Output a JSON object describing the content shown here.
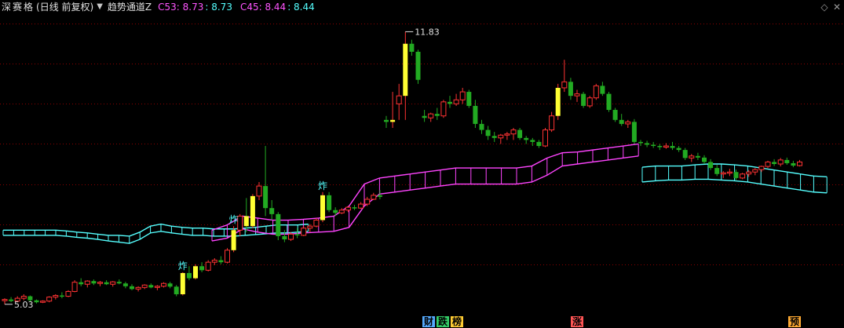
{
  "header": {
    "stock_name": "深赛格",
    "period": "(日线 前复权)",
    "dropdown_icon": "chevron-down-icon",
    "indicator_name": "趋势通道Z",
    "c53_label": "C53: 8.73",
    "c53_value": ": 8.73",
    "c45_label": "C45: 8.44",
    "c45_value": ": 8.44"
  },
  "window_controls": {
    "up_icon": "chevron-up-icon",
    "close_icon": "close-icon",
    "up_glyph": "◇",
    "close_glyph": "✕"
  },
  "price_annotations": {
    "high": "11.83",
    "low": "5.03"
  },
  "signals": {
    "explode_label": "炸"
  },
  "event_marks": [
    {
      "label": "财",
      "color": "#55aaff"
    },
    {
      "label": "跌",
      "color": "#33cc66"
    },
    {
      "label": "榜",
      "color": "#ffcc33"
    },
    {
      "label": "涨",
      "color": "#ff5555"
    },
    {
      "label": "预",
      "color": "#ffaa33"
    }
  ],
  "colors": {
    "up": "#ff3333",
    "down": "#22aa22",
    "limit_up": "#ffff33",
    "channel_cyan": "#55ffff",
    "channel_magenta": "#ff44ff",
    "grid": "#8b0000"
  },
  "chart_data": {
    "type": "candlestick",
    "y_range": [
      4.8,
      12.2
    ],
    "candles": [
      [
        5.1,
        5.15,
        5.0,
        5.12
      ],
      [
        5.12,
        5.18,
        5.05,
        5.08
      ],
      [
        5.08,
        5.2,
        5.05,
        5.15
      ],
      [
        5.15,
        5.25,
        5.1,
        5.2
      ],
      [
        5.2,
        5.22,
        5.05,
        5.1
      ],
      [
        5.1,
        5.12,
        5.02,
        5.05
      ],
      [
        5.05,
        5.1,
        5.03,
        5.08
      ],
      [
        5.08,
        5.2,
        5.05,
        5.18
      ],
      [
        5.18,
        5.25,
        5.12,
        5.22
      ],
      [
        5.22,
        5.3,
        5.15,
        5.2
      ],
      [
        5.2,
        5.35,
        5.18,
        5.32
      ],
      [
        5.32,
        5.6,
        5.3,
        5.55
      ],
      [
        5.55,
        5.65,
        5.45,
        5.5
      ],
      [
        5.5,
        5.6,
        5.42,
        5.58
      ],
      [
        5.58,
        5.62,
        5.48,
        5.52
      ],
      [
        5.52,
        5.58,
        5.45,
        5.55
      ],
      [
        5.55,
        5.6,
        5.48,
        5.5
      ],
      [
        5.5,
        5.58,
        5.44,
        5.56
      ],
      [
        5.56,
        5.62,
        5.5,
        5.52
      ],
      [
        5.52,
        5.56,
        5.4,
        5.45
      ],
      [
        5.45,
        5.5,
        5.35,
        5.38
      ],
      [
        5.38,
        5.45,
        5.32,
        5.42
      ],
      [
        5.42,
        5.5,
        5.38,
        5.48
      ],
      [
        5.48,
        5.52,
        5.4,
        5.42
      ],
      [
        5.42,
        5.48,
        5.35,
        5.45
      ],
      [
        5.45,
        5.55,
        5.42,
        5.52
      ],
      [
        5.52,
        5.56,
        5.4,
        5.44
      ],
      [
        5.44,
        5.48,
        5.2,
        5.25
      ],
      [
        5.25,
        5.8,
        5.22,
        5.78
      ],
      [
        5.78,
        5.95,
        5.6,
        5.65
      ],
      [
        5.65,
        6.0,
        5.62,
        5.95
      ],
      [
        5.95,
        6.05,
        5.8,
        5.85
      ],
      [
        5.85,
        6.1,
        5.82,
        6.05
      ],
      [
        6.05,
        6.15,
        5.98,
        6.1
      ],
      [
        6.1,
        6.2,
        6.0,
        6.05
      ],
      [
        6.05,
        6.4,
        6.02,
        6.35
      ],
      [
        6.35,
        6.95,
        6.3,
        6.85
      ],
      [
        6.85,
        7.25,
        6.7,
        7.2
      ],
      [
        7.2,
        7.65,
        6.8,
        6.95
      ],
      [
        6.95,
        7.75,
        6.9,
        7.7
      ],
      [
        7.7,
        8.05,
        7.6,
        7.95
      ],
      [
        7.95,
        8.95,
        7.2,
        7.4
      ],
      [
        7.4,
        7.6,
        7.1,
        7.25
      ],
      [
        7.25,
        7.3,
        6.6,
        6.7
      ],
      [
        6.7,
        6.85,
        6.55,
        6.62
      ],
      [
        6.62,
        6.8,
        6.58,
        6.75
      ],
      [
        6.75,
        6.9,
        6.65,
        6.72
      ],
      [
        6.72,
        6.95,
        6.7,
        6.9
      ],
      [
        6.9,
        7.0,
        6.8,
        6.95
      ],
      [
        6.95,
        7.15,
        6.92,
        7.1
      ],
      [
        7.1,
        7.8,
        7.05,
        7.72
      ],
      [
        7.72,
        7.8,
        7.3,
        7.35
      ],
      [
        7.35,
        7.42,
        7.2,
        7.28
      ],
      [
        7.28,
        7.4,
        7.25,
        7.35
      ],
      [
        7.35,
        7.45,
        7.3,
        7.42
      ],
      [
        7.42,
        7.48,
        7.35,
        7.4
      ],
      [
        7.4,
        7.55,
        7.38,
        7.5
      ],
      [
        7.5,
        7.68,
        7.45,
        7.62
      ],
      [
        7.62,
        7.78,
        7.6,
        7.72
      ],
      [
        7.72,
        7.85,
        7.62,
        7.68
      ],
      [
        9.6,
        9.7,
        9.4,
        9.55
      ],
      [
        9.55,
        10.3,
        9.4,
        9.6
      ],
      [
        10.0,
        10.5,
        9.6,
        10.2
      ],
      [
        10.2,
        11.8,
        9.6,
        11.5
      ],
      [
        11.5,
        11.6,
        11.2,
        11.3
      ],
      [
        11.3,
        11.35,
        10.5,
        10.6
      ],
      [
        9.7,
        9.85,
        9.55,
        9.65
      ],
      [
        9.65,
        9.78,
        9.55,
        9.75
      ],
      [
        9.75,
        9.9,
        9.6,
        9.7
      ],
      [
        9.7,
        10.1,
        9.65,
        10.05
      ],
      [
        10.05,
        10.2,
        9.9,
        10.0
      ],
      [
        10.0,
        10.25,
        9.95,
        10.1
      ],
      [
        10.1,
        10.4,
        10.0,
        10.3
      ],
      [
        10.3,
        10.35,
        9.9,
        9.95
      ],
      [
        9.95,
        10.1,
        9.4,
        9.5
      ],
      [
        9.5,
        9.6,
        9.25,
        9.35
      ],
      [
        9.35,
        9.45,
        9.1,
        9.2
      ],
      [
        9.2,
        9.3,
        9.05,
        9.15
      ],
      [
        9.15,
        9.25,
        9.0,
        9.22
      ],
      [
        9.22,
        9.3,
        9.1,
        9.25
      ],
      [
        9.25,
        9.4,
        9.1,
        9.35
      ],
      [
        9.35,
        9.4,
        9.1,
        9.15
      ],
      [
        9.15,
        9.2,
        9.0,
        9.1
      ],
      [
        9.1,
        9.15,
        8.95,
        9.05
      ],
      [
        9.05,
        9.1,
        8.9,
        8.95
      ],
      [
        8.95,
        9.4,
        8.92,
        9.35
      ],
      [
        9.35,
        9.8,
        9.3,
        9.7
      ],
      [
        9.7,
        10.5,
        9.6,
        10.4
      ],
      [
        10.4,
        11.1,
        10.3,
        10.55
      ],
      [
        10.55,
        10.65,
        10.1,
        10.2
      ],
      [
        10.2,
        10.35,
        10.05,
        10.25
      ],
      [
        10.25,
        10.3,
        9.9,
        9.95
      ],
      [
        9.95,
        10.2,
        9.9,
        10.15
      ],
      [
        10.15,
        10.5,
        10.1,
        10.45
      ],
      [
        10.45,
        10.55,
        10.2,
        10.25
      ],
      [
        10.25,
        10.3,
        9.8,
        9.85
      ],
      [
        9.85,
        9.9,
        9.55,
        9.6
      ],
      [
        9.6,
        9.75,
        9.45,
        9.5
      ],
      [
        9.5,
        9.6,
        9.4,
        9.55
      ],
      [
        9.55,
        9.62,
        9.0,
        9.05
      ],
      [
        9.05,
        9.1,
        8.95,
        9.02
      ],
      [
        9.02,
        9.08,
        8.92,
        8.98
      ],
      [
        8.98,
        9.05,
        8.9,
        8.95
      ],
      [
        8.95,
        9.0,
        8.85,
        8.92
      ],
      [
        8.92,
        9.02,
        8.88,
        8.95
      ],
      [
        8.95,
        9.05,
        8.85,
        8.9
      ],
      [
        8.9,
        8.95,
        8.8,
        8.85
      ],
      [
        8.85,
        8.9,
        8.6,
        8.65
      ],
      [
        8.65,
        8.75,
        8.55,
        8.7
      ],
      [
        8.7,
        8.78,
        8.6,
        8.66
      ],
      [
        8.66,
        8.72,
        8.5,
        8.55
      ],
      [
        8.55,
        8.62,
        8.35,
        8.4
      ],
      [
        8.4,
        8.48,
        8.2,
        8.25
      ],
      [
        8.25,
        8.32,
        8.15,
        8.28
      ],
      [
        8.28,
        8.38,
        8.2,
        8.3
      ],
      [
        8.3,
        8.36,
        8.1,
        8.15
      ],
      [
        8.15,
        8.28,
        8.12,
        8.25
      ],
      [
        8.25,
        8.35,
        8.18,
        8.3
      ],
      [
        8.3,
        8.4,
        8.22,
        8.36
      ],
      [
        8.36,
        8.46,
        8.3,
        8.44
      ],
      [
        8.44,
        8.58,
        8.4,
        8.55
      ],
      [
        8.55,
        8.62,
        8.45,
        8.5
      ],
      [
        8.5,
        8.65,
        8.44,
        8.6
      ],
      [
        8.6,
        8.66,
        8.48,
        8.52
      ],
      [
        8.52,
        8.58,
        8.42,
        8.46
      ],
      [
        8.46,
        8.6,
        8.44,
        8.55
      ]
    ],
    "limit_up_bars": [
      28,
      30,
      36,
      38,
      39,
      50,
      61,
      63,
      87
    ],
    "channel_cyan_upper": [
      6.85,
      6.85,
      6.85,
      6.85,
      6.85,
      6.85,
      6.83,
      6.8,
      6.78,
      6.75,
      6.72,
      6.72,
      6.7,
      6.8,
      6.95,
      7.0,
      6.95,
      6.92,
      6.9,
      6.9,
      6.88,
      6.88,
      6.88,
      6.9,
      6.92,
      6.95,
      6.98,
      6.98,
      6.98,
      7.0,
      8.42,
      8.45,
      8.45,
      8.45,
      8.48,
      8.5,
      8.5,
      8.48,
      8.45,
      8.4,
      8.35,
      8.3,
      8.25,
      8.2,
      8.18
    ],
    "channel_cyan_lower": [
      6.72,
      6.72,
      6.72,
      6.72,
      6.72,
      6.72,
      6.7,
      6.67,
      6.65,
      6.62,
      6.58,
      6.55,
      6.52,
      6.62,
      6.78,
      6.82,
      6.78,
      6.75,
      6.72,
      6.72,
      6.7,
      6.7,
      6.7,
      6.72,
      6.74,
      6.76,
      6.78,
      6.78,
      6.8,
      6.82,
      8.05,
      8.08,
      8.1,
      8.1,
      8.12,
      8.12,
      8.1,
      8.08,
      8.05,
      8.0,
      7.95,
      7.9,
      7.85,
      7.8,
      7.78
    ],
    "channel_magenta_upper": [
      6.85,
      6.98,
      7.2,
      7.15,
      7.1,
      7.1,
      7.12,
      7.15,
      7.2,
      7.45,
      8.0,
      8.15,
      8.2,
      8.25,
      8.3,
      8.35,
      8.4,
      8.4,
      8.4,
      8.4,
      8.4,
      8.45,
      8.65,
      8.78,
      8.8,
      8.85,
      8.9,
      8.95,
      9.0
    ],
    "channel_magenta_lower": [
      6.58,
      6.65,
      6.88,
      6.8,
      6.75,
      6.75,
      6.78,
      6.8,
      6.82,
      6.92,
      7.45,
      7.75,
      7.8,
      7.85,
      7.9,
      7.95,
      8.0,
      8.0,
      8.0,
      8.0,
      8.0,
      8.05,
      8.22,
      8.45,
      8.5,
      8.55,
      8.6,
      8.65,
      8.7
    ]
  }
}
